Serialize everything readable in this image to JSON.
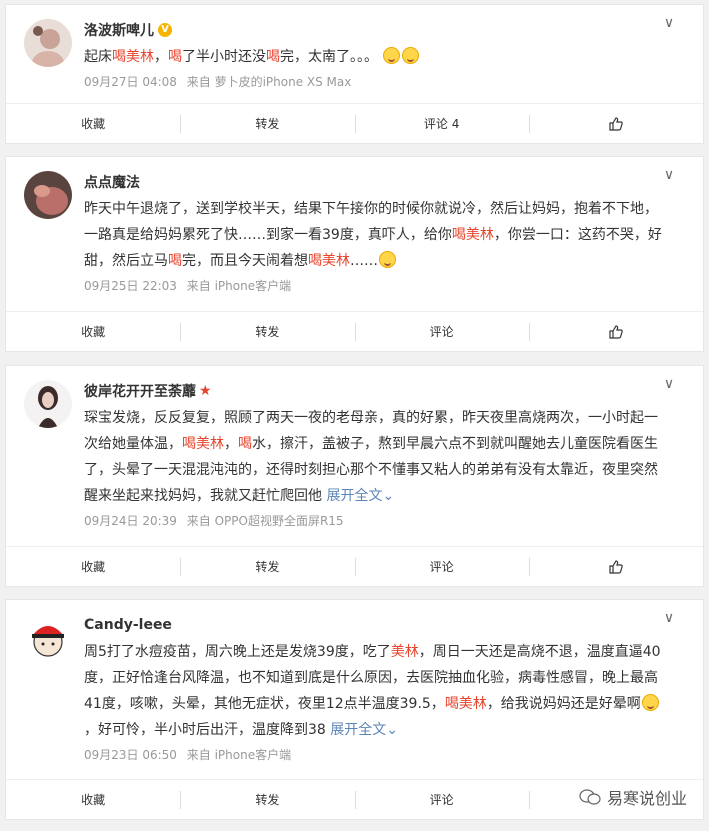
{
  "posts": [
    {
      "user": "洛波斯啤儿",
      "badge": "V",
      "text_parts": [
        {
          "t": "起床",
          "hl": false
        },
        {
          "t": "喝美林",
          "hl": true
        },
        {
          "t": "，",
          "hl": false
        },
        {
          "t": "喝",
          "hl": true
        },
        {
          "t": "了半小时还没",
          "hl": false
        },
        {
          "t": "喝",
          "hl": true
        },
        {
          "t": "完，太南了。。。",
          "hl": false
        }
      ],
      "time": "09月27日 04:08",
      "source": "来自 萝卜皮的iPhone XS Max",
      "actions": {
        "collect": "收藏",
        "repost": "转发",
        "comment": "评论 4"
      }
    },
    {
      "user": "点点魔法",
      "text_parts": [
        {
          "t": "昨天中午退烧了，送到学校半天，结果下午接你的时候你就说冷，然后让妈妈，抱着不下地，一路真是给妈妈累死了快……到家一看39度，真吓人，给你",
          "hl": false
        },
        {
          "t": "喝美林",
          "hl": true
        },
        {
          "t": "，你尝一口：这药不哭，好甜，然后立马",
          "hl": false
        },
        {
          "t": "喝",
          "hl": true
        },
        {
          "t": "完，而且今天闹着想",
          "hl": false
        },
        {
          "t": "喝美林",
          "hl": true
        },
        {
          "t": "……",
          "hl": false
        }
      ],
      "time": "09月25日 22:03",
      "source": "来自 iPhone客户端",
      "actions": {
        "collect": "收藏",
        "repost": "转发",
        "comment": "评论"
      }
    },
    {
      "user": "彼岸花开开至荼蘼",
      "badge": "★",
      "text_parts": [
        {
          "t": "琛宝发烧，反反复复，照顾了两天一夜的老母亲，真的好累，昨天夜里高烧两次，一小时起一次给她量体温，",
          "hl": false
        },
        {
          "t": "喝美林",
          "hl": true
        },
        {
          "t": "，",
          "hl": false
        },
        {
          "t": "喝",
          "hl": true
        },
        {
          "t": "水，擦汗，盖被子，熬到早晨六点不到就叫醒她去儿童医院看医生了，头晕了一天混混沌沌的，还得时刻担心那个不懂事又粘人的弟弟有没有太靠近，夜里突然醒来坐起来找妈妈，我就又赶忙爬回他 ",
          "hl": false
        }
      ],
      "more": "展开全文",
      "time": "09月24日 20:39",
      "source": "来自 OPPO超视野全面屏R15",
      "actions": {
        "collect": "收藏",
        "repost": "转发",
        "comment": "评论"
      }
    },
    {
      "user": "Candy-leee",
      "text_parts": [
        {
          "t": "周5打了水痘疫苗，周六晚上还是发烧39度，吃了",
          "hl": false
        },
        {
          "t": "美林",
          "hl": true
        },
        {
          "t": "，周日一天还是高烧不退，温度直逼40度，正好恰逢台风降温，也不知道到底是什么原因，去医院抽血化验，病毒性感冒，晚上最高41度，咳嗽，头晕，其他无症状，夜里12点半温度39.5，",
          "hl": false
        },
        {
          "t": "喝美林",
          "hl": true
        },
        {
          "t": "，给我说妈妈还是好晕啊",
          "hl": false
        },
        {
          "t": "，好可怜，半小时后出汗，温度降到38 ",
          "hl": false
        }
      ],
      "more": "展开全文",
      "time": "09月23日 06:50",
      "source": "来自 iPhone客户端",
      "actions": {
        "collect": "收藏",
        "repost": "转发",
        "comment": "评论"
      }
    }
  ],
  "watermark": "易寒说创业",
  "menu_glyph": "∨"
}
